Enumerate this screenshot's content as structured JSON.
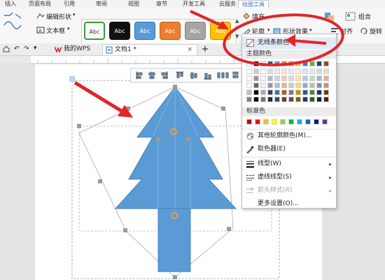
{
  "menu": {
    "tabs": [
      {
        "label": "插入"
      },
      {
        "label": "页面布局"
      },
      {
        "label": "引用"
      },
      {
        "label": "审阅"
      },
      {
        "label": "视图"
      },
      {
        "label": "章节"
      },
      {
        "label": "开发工具"
      },
      {
        "label": "云服务"
      },
      {
        "label": "绘图工具"
      }
    ],
    "active_index": 8
  },
  "ribbon": {
    "edit_shape": "编辑形状",
    "text_box": "文本框",
    "fill": "填充",
    "outline": "轮廓",
    "shape_effects": "形状效果",
    "align": "对齐",
    "rotate": "旋转",
    "group": "组合",
    "style_swatches": [
      {
        "label": "Abc",
        "bg": "#ffffff",
        "fg": "#333333",
        "border": "#3a9b3a"
      },
      {
        "label": "Abc",
        "bg": "#111111",
        "fg": "#ffffff",
        "border": "#111111"
      },
      {
        "label": "Abc",
        "bg": "#5b9bd5",
        "fg": "#ffffff",
        "border": "#2e75b6"
      },
      {
        "label": "Abc",
        "bg": "#ed7d31",
        "fg": "#ffffff",
        "border": "#c55a11"
      },
      {
        "label": "Abc",
        "bg": "#a5a5a5",
        "fg": "#ffffff",
        "border": "#7f7f7f"
      },
      {
        "label": "Abc",
        "bg": "#ffc000",
        "fg": "#ffffff",
        "border": "#bf9000"
      }
    ]
  },
  "tabs": {
    "wps_tab": "我的WPS",
    "doc_tab": "文档1 *",
    "add": "+"
  },
  "dropdown": {
    "no_line_color": "无线条颜色",
    "theme_colors_header": "主题颜色",
    "standard_colors_header": "标准色",
    "more_outline_colors": "其他轮廓颜色(M)...",
    "color_picker": "取色器(E)",
    "line_type": "线型(W)",
    "dash_type": "虚线线型(S)",
    "arrow_style": "箭头样式(R)",
    "more_settings": "更多设置(O)...",
    "theme_top_row": [
      "#ffffff",
      "#000000",
      "#e7e6e6",
      "#44546a",
      "#5b9bd5",
      "#ed7d31",
      "#a5a5a5",
      "#ffc000",
      "#4472c4",
      "#70ad47",
      "#264478",
      "#9e480e"
    ],
    "standard_row": [
      "#c00000",
      "#ff0000",
      "#ffc000",
      "#ffff00",
      "#92d050",
      "#00b050",
      "#00b0f0",
      "#0070c0",
      "#002060",
      "#7030a0"
    ]
  },
  "colors": {
    "accent_red": "#e0262b",
    "tree_fill": "#5b9bd5",
    "tree_stroke": "#4a7fb8",
    "handle": "#9a9a9a",
    "rotation_handle": "#e7a23a",
    "ribbon_active_tab": "#2f6fc2"
  },
  "icons": {
    "outline": "pencil-outline-icon",
    "shape_effects": "effects-icon",
    "color_picker": "eyedropper-icon",
    "no_line": "no-line-icon"
  }
}
